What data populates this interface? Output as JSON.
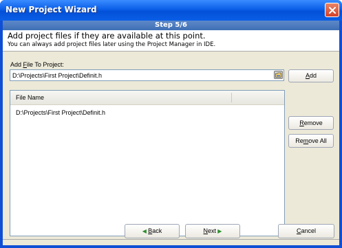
{
  "window": {
    "title": "New Project Wizard",
    "step": "Step 5/6"
  },
  "header": {
    "main": "Add project files if they are available at this point.",
    "sub": "You can always add project files later using the Project Manager in IDE."
  },
  "add_file": {
    "label_prefix": "Add ",
    "label_mnemonic": "F",
    "label_suffix": "ile To Project:",
    "value": "D:\\Projects\\First Project\\Definit.h"
  },
  "buttons": {
    "add_mnemonic": "A",
    "add_rest": "dd",
    "remove_mnemonic": "R",
    "remove_rest": "emove",
    "remove_all_prefix": "Re",
    "remove_all_mnemonic": "m",
    "remove_all_suffix": "ove All",
    "back_mnemonic": "B",
    "back_rest": "ack",
    "next_mnemonic": "N",
    "next_rest": "ext",
    "cancel_mnemonic": "C",
    "cancel_rest": "ancel"
  },
  "file_list": {
    "column": "File Name",
    "rows": [
      "D:\\Projects\\First Project\\Definit.h"
    ]
  },
  "icons": {
    "close": "close-icon",
    "browse": "browse-folder-icon",
    "back": "left-arrow-icon",
    "next": "right-arrow-icon"
  },
  "colors": {
    "titlebar": "#0b5fe8",
    "close": "#d4412a",
    "step_bar": "#4a79bd",
    "dialog": "#ece9d8",
    "arrow": "#2f8f2f"
  }
}
